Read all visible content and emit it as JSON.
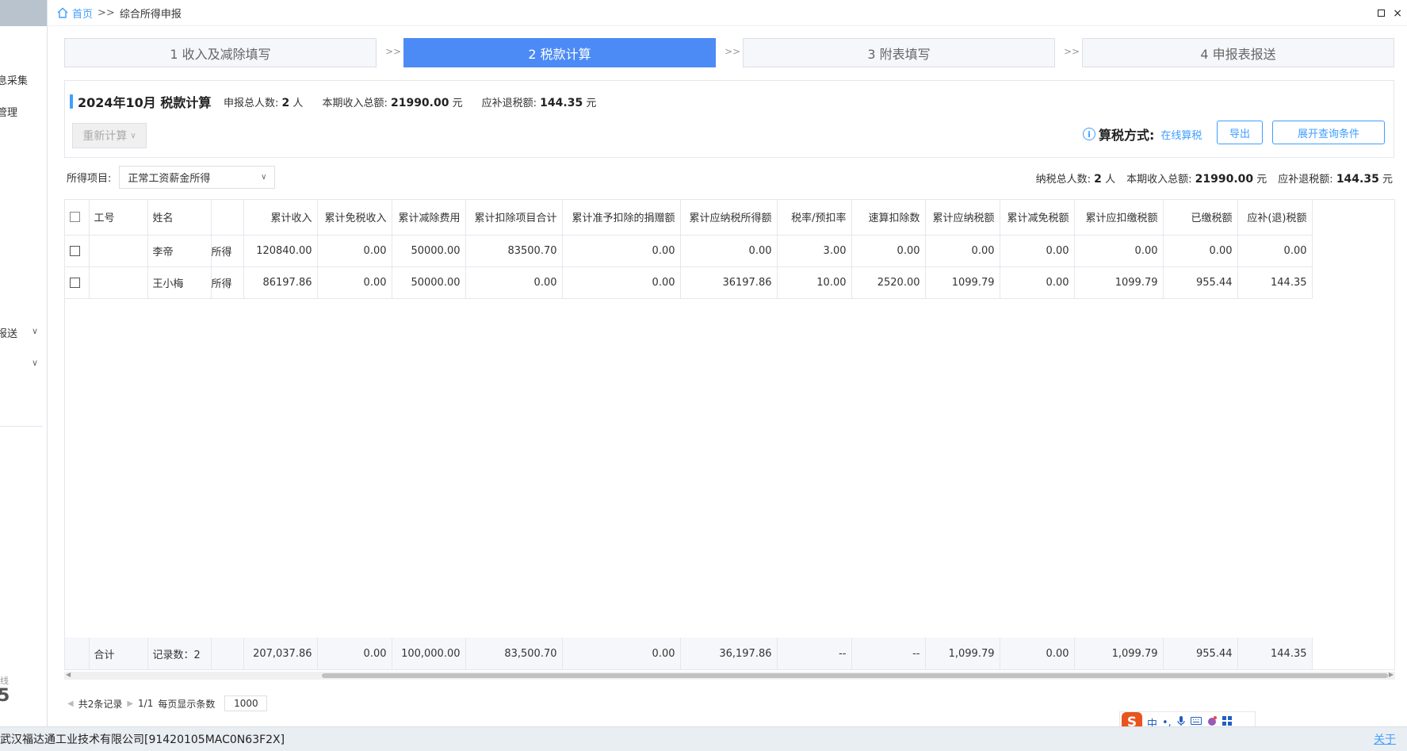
{
  "sidebar": {
    "items": [
      {
        "label": "息采集"
      },
      {
        "label": "管理"
      },
      {
        "label": "报送"
      }
    ],
    "faded_text": "线",
    "big_text": "5"
  },
  "breadcrumb": {
    "home": "首页",
    "sep": ">>",
    "current": "综合所得申报"
  },
  "window": {
    "close": "×"
  },
  "steps": [
    {
      "label": "1 收入及减除填写",
      "active": false
    },
    {
      "label": "2 税款计算",
      "active": true
    },
    {
      "label": "3 附表填写",
      "active": false
    },
    {
      "label": "4 申报表报送",
      "active": false
    }
  ],
  "step_arrow": ">>",
  "summary": {
    "title": "2024年10月  税款计算",
    "total_people_label": "申报总人数:",
    "total_people_value": "2",
    "people_unit": "人",
    "income_label": "本期收入总额:",
    "income_value": "21990.00",
    "yuan": "元",
    "refund_label": "应补退税额:",
    "refund_value": "144.35",
    "recalc_button": "重新计算",
    "calc_mode_label": "算税方式:",
    "calc_mode_value": "在线算税",
    "export_button": "导出",
    "expand_button": "展开查询条件"
  },
  "filter": {
    "label": "所得项目:",
    "selected": "正常工资薪金所得",
    "taxpayers_label": "纳税总人数:",
    "taxpayers_value": "2",
    "people_unit": "人",
    "income_label": "本期收入总额:",
    "income_value": "21990.00",
    "yuan": "元",
    "refund_label": "应补退税额:",
    "refund_value": "144.35"
  },
  "table": {
    "headers": [
      "工号",
      "姓名",
      "",
      "累计收入",
      "累计免税收入",
      "累计减除费用",
      "累计扣除项目合计",
      "累计准予扣除的捐赠额",
      "累计应纳税所得额",
      "税率/预扣率",
      "速算扣除数",
      "累计应纳税额",
      "累计减免税额",
      "累计应扣缴税额",
      "已缴税额",
      "应补(退)税额"
    ],
    "rows": [
      [
        "",
        "李帝",
        "所得",
        "120840.00",
        "0.00",
        "50000.00",
        "83500.70",
        "0.00",
        "0.00",
        "3.00",
        "0.00",
        "0.00",
        "0.00",
        "0.00",
        "0.00",
        "0.00"
      ],
      [
        "",
        "王小梅",
        "所得",
        "86197.86",
        "0.00",
        "50000.00",
        "0.00",
        "0.00",
        "36197.86",
        "10.00",
        "2520.00",
        "1099.79",
        "0.00",
        "1099.79",
        "955.44",
        "144.35"
      ]
    ],
    "footer": [
      "合计",
      "记录数：2",
      "",
      "207,037.86",
      "0.00",
      "100,000.00",
      "83,500.70",
      "0.00",
      "36,197.86",
      "--",
      "--",
      "1,099.79",
      "0.00",
      "1,099.79",
      "955.44",
      "144.35"
    ]
  },
  "pager": {
    "total": "共2条记录",
    "page": "1/1",
    "per_page_label": "每页显示条数",
    "per_page_value": "1000"
  },
  "ime": {
    "logo": "S",
    "mode": "中",
    "punct": "•,"
  },
  "status": {
    "company": "武汉福达通工业技术有限公司[91420105MAC0N63F2X]",
    "close": "关于"
  },
  "colors": {
    "accent": "#409eff",
    "active_step": "#4c8bf5"
  }
}
